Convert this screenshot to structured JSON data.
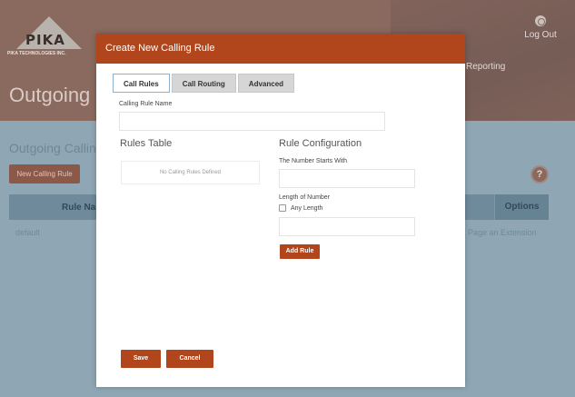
{
  "background": {
    "logo_text": "PIKA",
    "logo_tagline": "PIKA TECHNOLOGIES INC.",
    "page_title": "Outgoing C",
    "logout_label": "Log Out",
    "nav_reporting": "Reporting",
    "section_title": "Outgoing Calling",
    "new_rule_button": "New Calling Rule",
    "help_icon": "?",
    "table": {
      "col_rule_name": "Rule Name",
      "col_options": "Options",
      "row_name": "default",
      "row_action": "Page an Extension"
    }
  },
  "modal": {
    "title": "Create New Calling Rule",
    "tabs": [
      {
        "label": "Call Rules",
        "active": true
      },
      {
        "label": "Call Routing",
        "active": false
      },
      {
        "label": "Advanced",
        "active": false
      }
    ],
    "calling_rule_name_label": "Calling Rule Name",
    "calling_rule_name_value": "",
    "rules_table": {
      "title": "Rules Table",
      "empty_text": "No Calling Rules Defined"
    },
    "rule_configuration": {
      "title": "Rule Configuration",
      "starts_with_label": "The Number Starts With",
      "starts_with_value": "",
      "length_label": "Length of Number",
      "any_length_label": "Any Length",
      "any_length_checked": false,
      "length_value": "",
      "add_rule_button": "Add Rule"
    },
    "save_button": "Save",
    "cancel_button": "Cancel"
  },
  "colors": {
    "accent": "#b1461c",
    "header_bg": "#8a6a5e",
    "page_bg": "#8fa7b5"
  }
}
